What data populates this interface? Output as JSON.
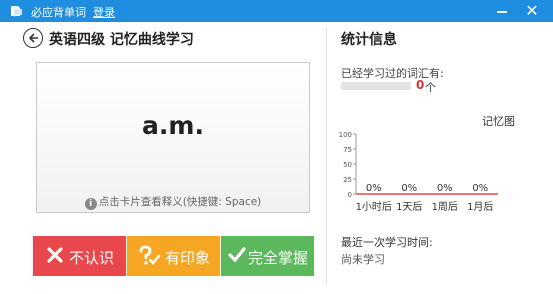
{
  "app": {
    "title": "必应背单词",
    "login_label": "登录",
    "close_glyph": "✕",
    "brand_color": "#1f8ee0"
  },
  "header": {
    "title": "英语四级 记忆曲线学习",
    "back_icon": "back-arrow-icon"
  },
  "card": {
    "word": "a.m.",
    "hint": "点击卡片查看释义(快捷键: Space)",
    "hint_icon_glyph": "i"
  },
  "actions": [
    {
      "label": "不认识",
      "icon": "x-icon",
      "color": "#e8474c"
    },
    {
      "label": "有印象",
      "icon": "question-check-icon",
      "color": "#f5a623"
    },
    {
      "label": "完全掌握",
      "icon": "check-icon",
      "color": "#5cb85c"
    }
  ],
  "stats": {
    "title": "统计信息",
    "learned_label": "已经学习过的词汇有:",
    "learned_count": "0",
    "learned_unit": "个",
    "learned_progress": 0,
    "last_study_label": "最近一次学习时间:",
    "last_study_value": "尚未学习"
  },
  "chart_data": {
    "type": "bar",
    "title": "记忆图",
    "categories": [
      "1小时后",
      "1天后",
      "1周后",
      "1月后"
    ],
    "values": [
      0,
      0,
      0,
      0
    ],
    "data_labels": [
      "0%",
      "0%",
      "0%",
      "0%"
    ],
    "yticks": [
      "100",
      "75",
      "50",
      "25",
      "0"
    ],
    "ylim": [
      0,
      100
    ],
    "grid": false,
    "legend": "none",
    "bar_color": "#e8474c",
    "axis_color": "#e8474c"
  }
}
